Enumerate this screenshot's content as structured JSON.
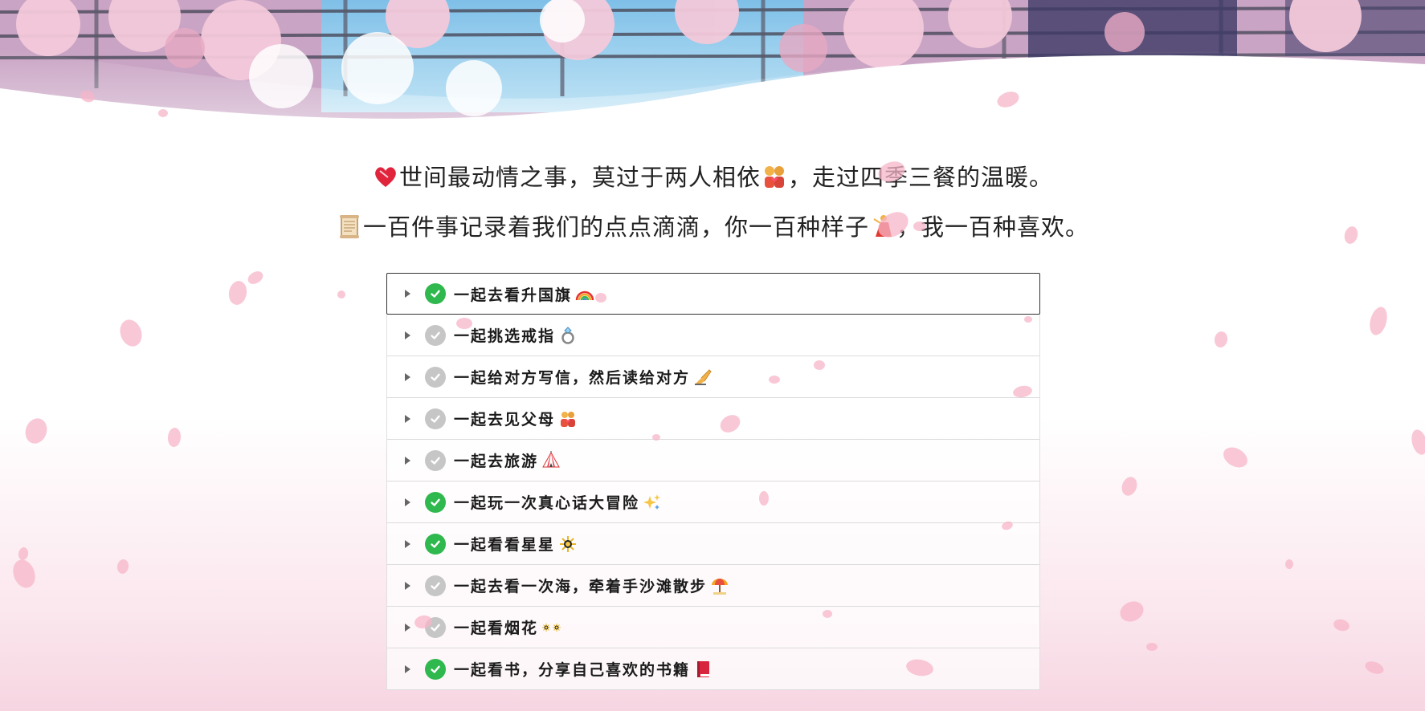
{
  "quotes": [
    {
      "text_a": "世间最动情之事，莫过于两人相依",
      "text_b": "，走过四季三餐的温暖。",
      "lead_icon": "heart-icon",
      "mid_icon": "couple-icon"
    },
    {
      "text_a": "一百件事记录着我们的点点滴滴，你一百种样子",
      "text_b": "，我一百种喜欢。",
      "lead_icon": "scroll-icon",
      "mid_icon": "dancer-icon"
    }
  ],
  "items": [
    {
      "label": "一起去看升国旗",
      "done": true,
      "icon": "rainbow-icon"
    },
    {
      "label": "一起挑选戒指",
      "done": false,
      "icon": "ring-icon"
    },
    {
      "label": "一起给对方写信，然后读给对方",
      "done": false,
      "icon": "writing-hand-icon"
    },
    {
      "label": "一起去见父母",
      "done": false,
      "icon": "family-icon"
    },
    {
      "label": "一起去旅游",
      "done": false,
      "icon": "circus-tent-icon"
    },
    {
      "label": "一起玩一次真心话大冒险",
      "done": true,
      "icon": "sparkles-icon"
    },
    {
      "label": "一起看看星星",
      "done": true,
      "icon": "sparkler-icon"
    },
    {
      "label": "一起去看一次海，牵着手沙滩散步",
      "done": false,
      "icon": "umbrella-beach-icon"
    },
    {
      "label": "一起看烟花",
      "done": false,
      "icon": "fireworks-icon"
    },
    {
      "label": "一起看书，分享自己喜欢的书籍",
      "done": true,
      "icon": "book-icon"
    }
  ],
  "colors": {
    "done": "#2fb84d",
    "todo": "#c6c6c6",
    "petal": "#f7b6c8"
  }
}
